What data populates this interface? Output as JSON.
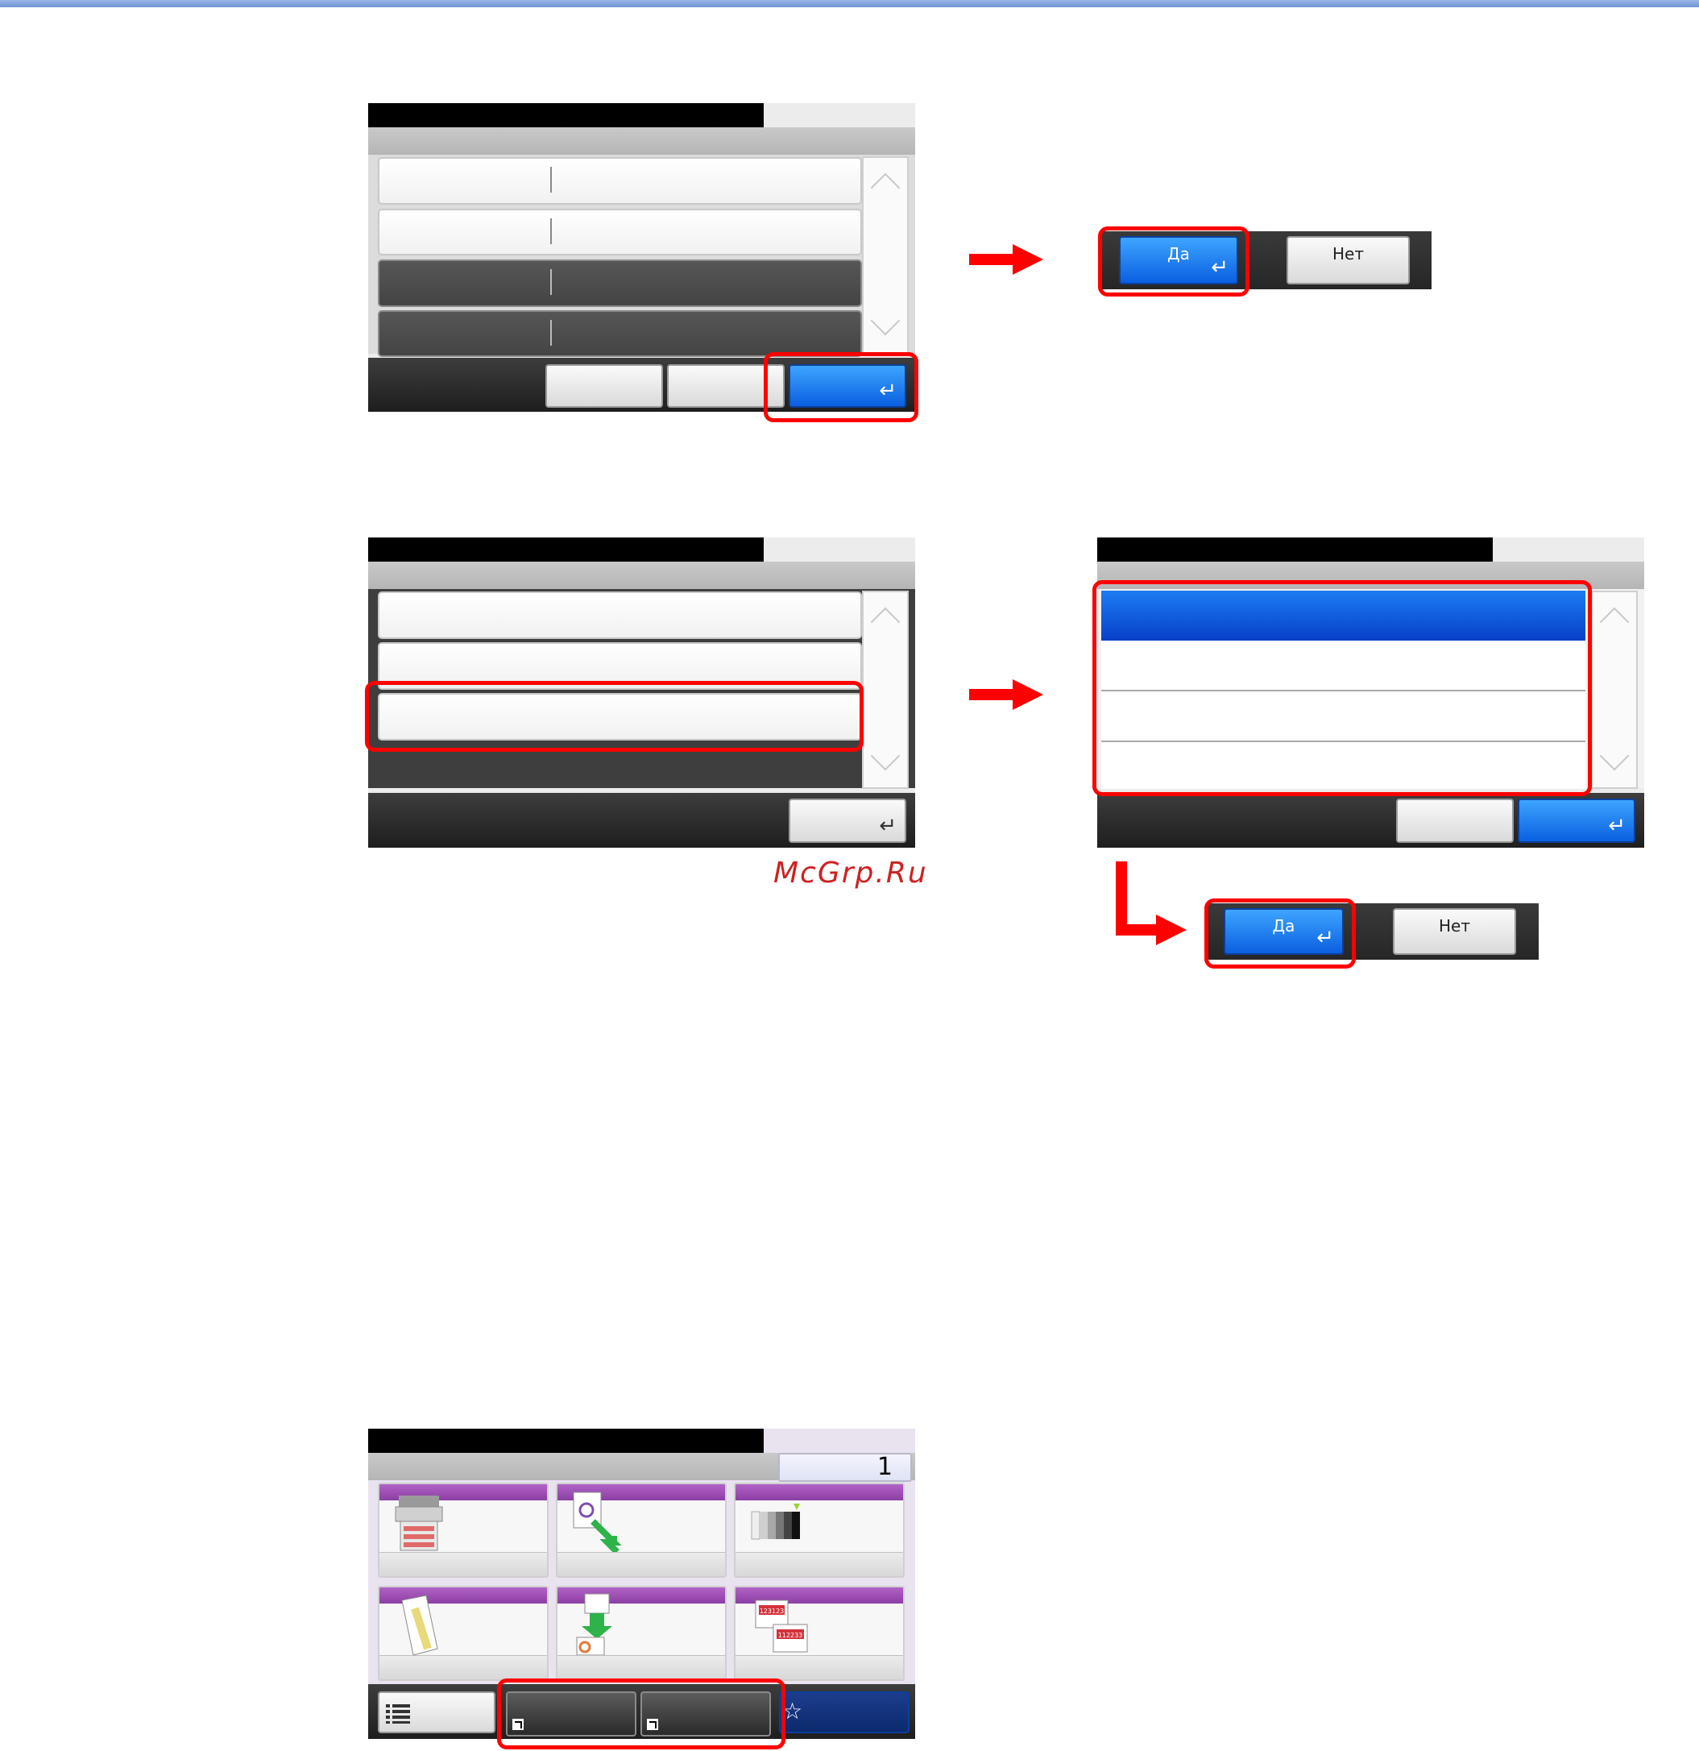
{
  "dialog_top": {
    "yes_label": "Да",
    "no_label": "Нет",
    "enter_glyph": "↵"
  },
  "dialog_bottom": {
    "yes_label": "Да",
    "no_label": "Нет",
    "enter_glyph": "↵"
  },
  "watermark": "McGrp.Ru",
  "home_screen": {
    "page_number": "1",
    "icons": [
      "copier-icon",
      "document-box-icon",
      "color-adjust-icon",
      "paper-icon",
      "scan-to-box-icon",
      "collate-icon"
    ],
    "collate_labels": [
      "123123",
      "112233"
    ]
  },
  "colors": {
    "highlight": "#ff0000",
    "accent_blue": "#0b5fe0",
    "tile_purple": "#8c3fa3"
  }
}
